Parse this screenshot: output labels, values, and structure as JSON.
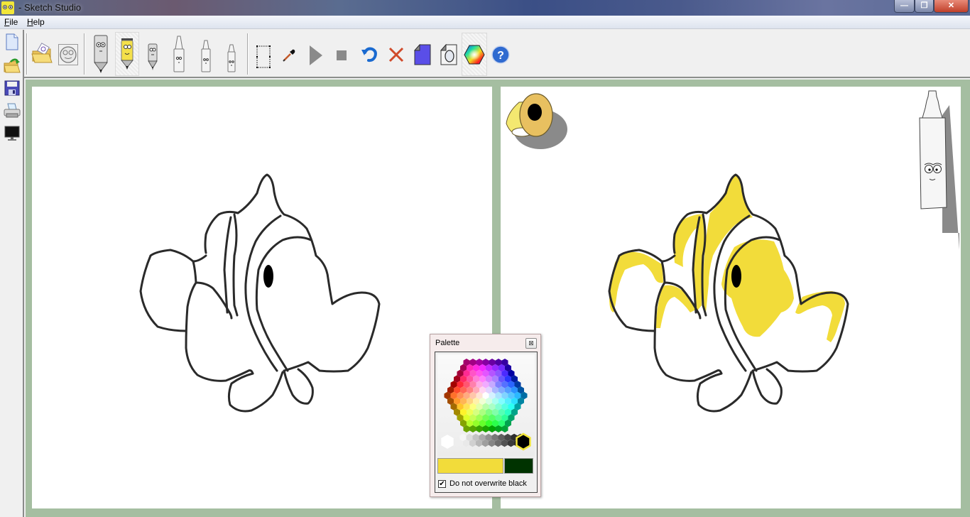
{
  "window": {
    "title": "- Sketch Studio",
    "controls": {
      "minimize": "—",
      "maximize": "❐",
      "close": "✕"
    }
  },
  "menu": {
    "items": [
      {
        "label": "File",
        "accel": "F"
      },
      {
        "label": "Help",
        "accel": "H"
      }
    ]
  },
  "sidebar": {
    "items": [
      {
        "name": "new-file",
        "icon": "new-document-icon"
      },
      {
        "name": "open-file",
        "icon": "open-folder-arrow-icon"
      },
      {
        "name": "save",
        "icon": "floppy-disk-icon"
      },
      {
        "name": "print",
        "icon": "printer-icon"
      },
      {
        "name": "display",
        "icon": "monitor-icon"
      }
    ]
  },
  "toolbar": {
    "tools": [
      {
        "name": "open-picture",
        "icon": "folder-picture-icon"
      },
      {
        "name": "face-template",
        "icon": "smiley-face-icon"
      },
      {
        "name": "thick-pencil-gray",
        "icon": "pencil-character-icon"
      },
      {
        "name": "pencil-yellow",
        "icon": "pencil-character-icon",
        "selected": true
      },
      {
        "name": "small-pencil-gray",
        "icon": "pencil-character-icon"
      },
      {
        "name": "marker-large",
        "icon": "marker-character-icon"
      },
      {
        "name": "marker-medium",
        "icon": "marker-character-icon"
      },
      {
        "name": "marker-small",
        "icon": "marker-character-icon"
      },
      {
        "name": "select-region",
        "icon": "selection-rectangle-icon"
      },
      {
        "name": "eyedropper",
        "icon": "eyedropper-icon"
      },
      {
        "name": "play",
        "icon": "play-icon"
      },
      {
        "name": "stop",
        "icon": "stop-icon"
      },
      {
        "name": "undo",
        "icon": "undo-icon"
      },
      {
        "name": "delete",
        "icon": "delete-x-icon"
      },
      {
        "name": "fill-page",
        "icon": "filled-page-icon"
      },
      {
        "name": "page-outline",
        "icon": "page-outline-icon"
      },
      {
        "name": "palette",
        "icon": "color-hexagon-icon",
        "selected": true
      },
      {
        "name": "help",
        "icon": "help-icon"
      }
    ]
  },
  "palette": {
    "title": "Palette",
    "close": "⊠",
    "primary_color": "#f2dc3a",
    "secondary_color": "#003300",
    "selected_swatch": "#000000",
    "checkbox_label": "Do not overwrite black",
    "checkbox_checked": true,
    "checkmark": "✔"
  },
  "colors": {
    "workspace": "#a5bea1",
    "fill_yellow": "#f2dc3a",
    "outline": "#2a2a2a"
  }
}
